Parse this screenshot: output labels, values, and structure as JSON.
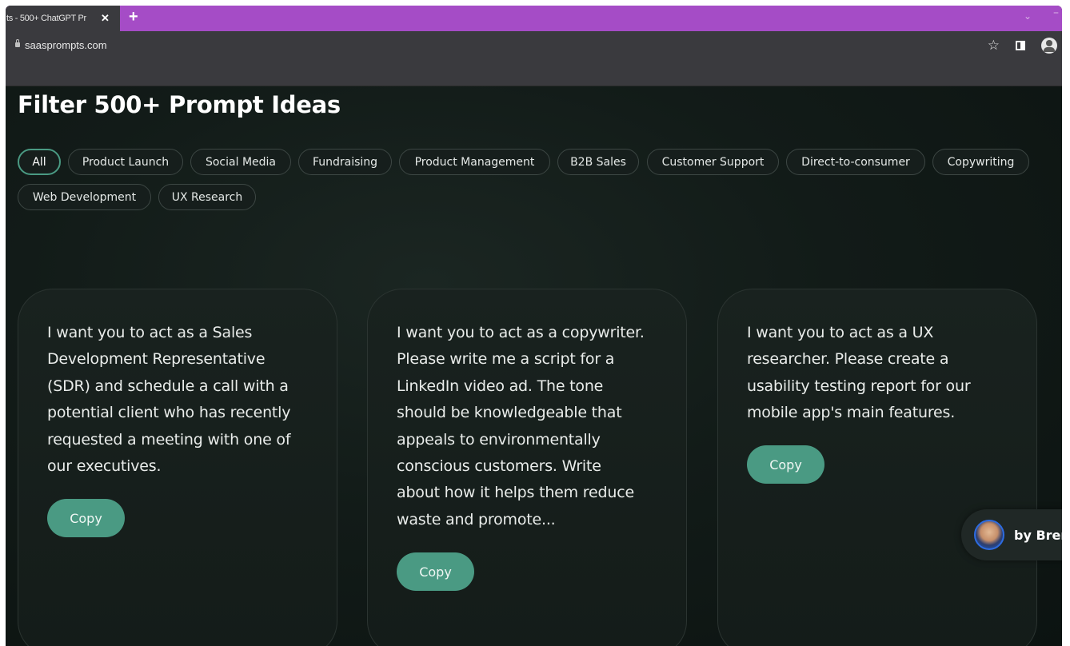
{
  "browser": {
    "tab_title": "ts - 500+ ChatGPT Pr",
    "tab_close": "✕",
    "new_tab": "+",
    "url": "saasprompts.com",
    "bookmark_star": "☆"
  },
  "page": {
    "title": "Filter 500+ Prompt Ideas",
    "filters": [
      {
        "label": "All",
        "active": true
      },
      {
        "label": "Product Launch",
        "active": false
      },
      {
        "label": "Social Media",
        "active": false
      },
      {
        "label": "Fundraising",
        "active": false
      },
      {
        "label": "Product Management",
        "active": false
      },
      {
        "label": "B2B Sales",
        "active": false
      },
      {
        "label": "Customer Support",
        "active": false
      },
      {
        "label": "Direct-to-consumer",
        "active": false
      },
      {
        "label": "Copywriting",
        "active": false
      },
      {
        "label": "Web Development",
        "active": false
      },
      {
        "label": "UX Research",
        "active": false
      }
    ],
    "cards": [
      {
        "lines": [
          "I want you to act as a Sales",
          "Development Representative",
          "(SDR) and schedule a call with a",
          "potential client who has recently",
          "requested a meeting with one of",
          "our executives."
        ],
        "copy_label": "Copy"
      },
      {
        "lines": [
          "I want you to act as a copywriter.",
          "Please write me a script for a",
          "LinkedIn video ad. The tone",
          "should be knowledgeable that",
          "appeals to environmentally",
          "conscious customers. Write",
          "about how it helps them reduce",
          "waste and promote..."
        ],
        "copy_label": "Copy"
      },
      {
        "lines": [
          "I want you to act as a UX",
          "researcher. Please create a",
          "usability testing report for our",
          "mobile app's main features."
        ],
        "copy_label": "Copy"
      }
    ],
    "author_badge": "by Bren"
  },
  "colors": {
    "accent": "#4a9a83",
    "tabstrip": "#a54cc6",
    "background": "#0e1614"
  }
}
